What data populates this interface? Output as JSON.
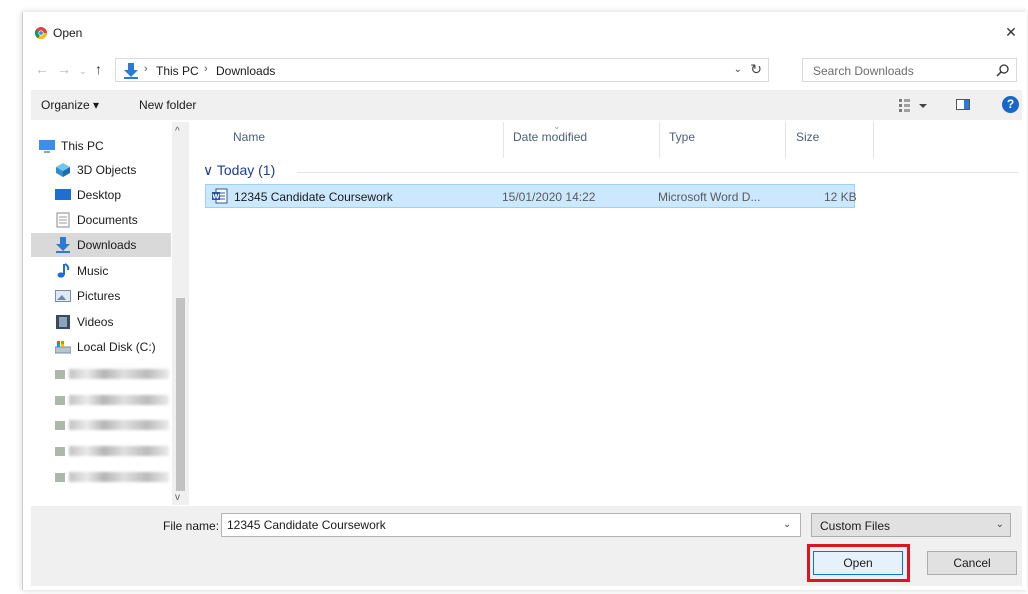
{
  "window": {
    "title": "Open",
    "close_glyph": "✕"
  },
  "nav": {
    "back_glyph": "←",
    "forward_glyph": "→",
    "recent_glyph": "⌄",
    "up_glyph": "↑",
    "breadcrumb": [
      "This PC",
      "Downloads"
    ],
    "separator_glyph": "›",
    "dropdown_glyph": "⌄",
    "refresh_glyph": "↻"
  },
  "search": {
    "placeholder": "Search Downloads"
  },
  "toolbar": {
    "organize_label": "Organize ▾",
    "new_folder_label": "New folder",
    "help_glyph": "?"
  },
  "sidebar": {
    "items": [
      {
        "label": "This PC",
        "icon": "computer-icon"
      },
      {
        "label": "3D Objects",
        "icon": "cube-icon"
      },
      {
        "label": "Desktop",
        "icon": "desktop-icon"
      },
      {
        "label": "Documents",
        "icon": "document-icon"
      },
      {
        "label": "Downloads",
        "icon": "download-arrow-icon",
        "selected": true
      },
      {
        "label": "Music",
        "icon": "music-note-icon"
      },
      {
        "label": "Pictures",
        "icon": "picture-icon"
      },
      {
        "label": "Videos",
        "icon": "film-icon"
      },
      {
        "label": "Local Disk (C:)",
        "icon": "drive-icon"
      }
    ],
    "scroll_up_glyph": "^",
    "scroll_down_glyph": "v"
  },
  "filelist": {
    "columns": [
      "Name",
      "Date modified",
      "Type",
      "Size"
    ],
    "sort_glyph": "⌄",
    "group": {
      "label": "Today (1)",
      "toggle_glyph": "∨"
    },
    "rows": [
      {
        "name": "12345 Candidate Coursework",
        "date": "15/01/2020 14:22",
        "type": "Microsoft Word D...",
        "size": "12 KB"
      }
    ]
  },
  "footer": {
    "filename_label": "File name:",
    "filename_value": "12345 Candidate Coursework",
    "dropdown_glyph": "⌄",
    "filter_label": "Custom Files",
    "open_label": "Open",
    "cancel_label": "Cancel"
  },
  "colors": {
    "accent": "#0078d7",
    "selection": "#cce8ff",
    "highlight": "#e0141e"
  }
}
